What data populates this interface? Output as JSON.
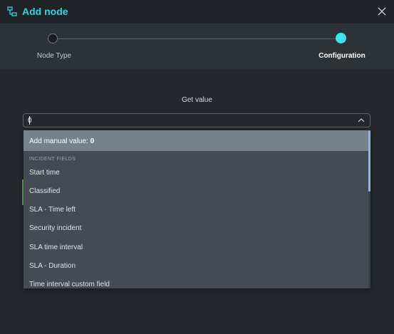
{
  "modal": {
    "title": "Add node",
    "header_icon": "flow-node-icon",
    "close_icon": "close-icon",
    "accent_color": "#36d2e0"
  },
  "stepper": {
    "steps": [
      {
        "label": "Node Type",
        "state": "completed"
      },
      {
        "label": "Configuration",
        "state": "active"
      }
    ]
  },
  "form": {
    "field_label": "Get value",
    "input_value": "0",
    "chevron_icon": "chevron-up-icon"
  },
  "dropdown": {
    "manual_prefix": "Add manual value: ",
    "manual_value": "0",
    "section_header": "INCIDENT FIELDS",
    "items": [
      {
        "label": "Start time"
      },
      {
        "label": "Classified"
      },
      {
        "label": "SLA - Time left"
      },
      {
        "label": "Security incident"
      },
      {
        "label": "SLA time interval"
      },
      {
        "label": "SLA - Duration"
      },
      {
        "label": "Time interval custom field"
      }
    ]
  }
}
